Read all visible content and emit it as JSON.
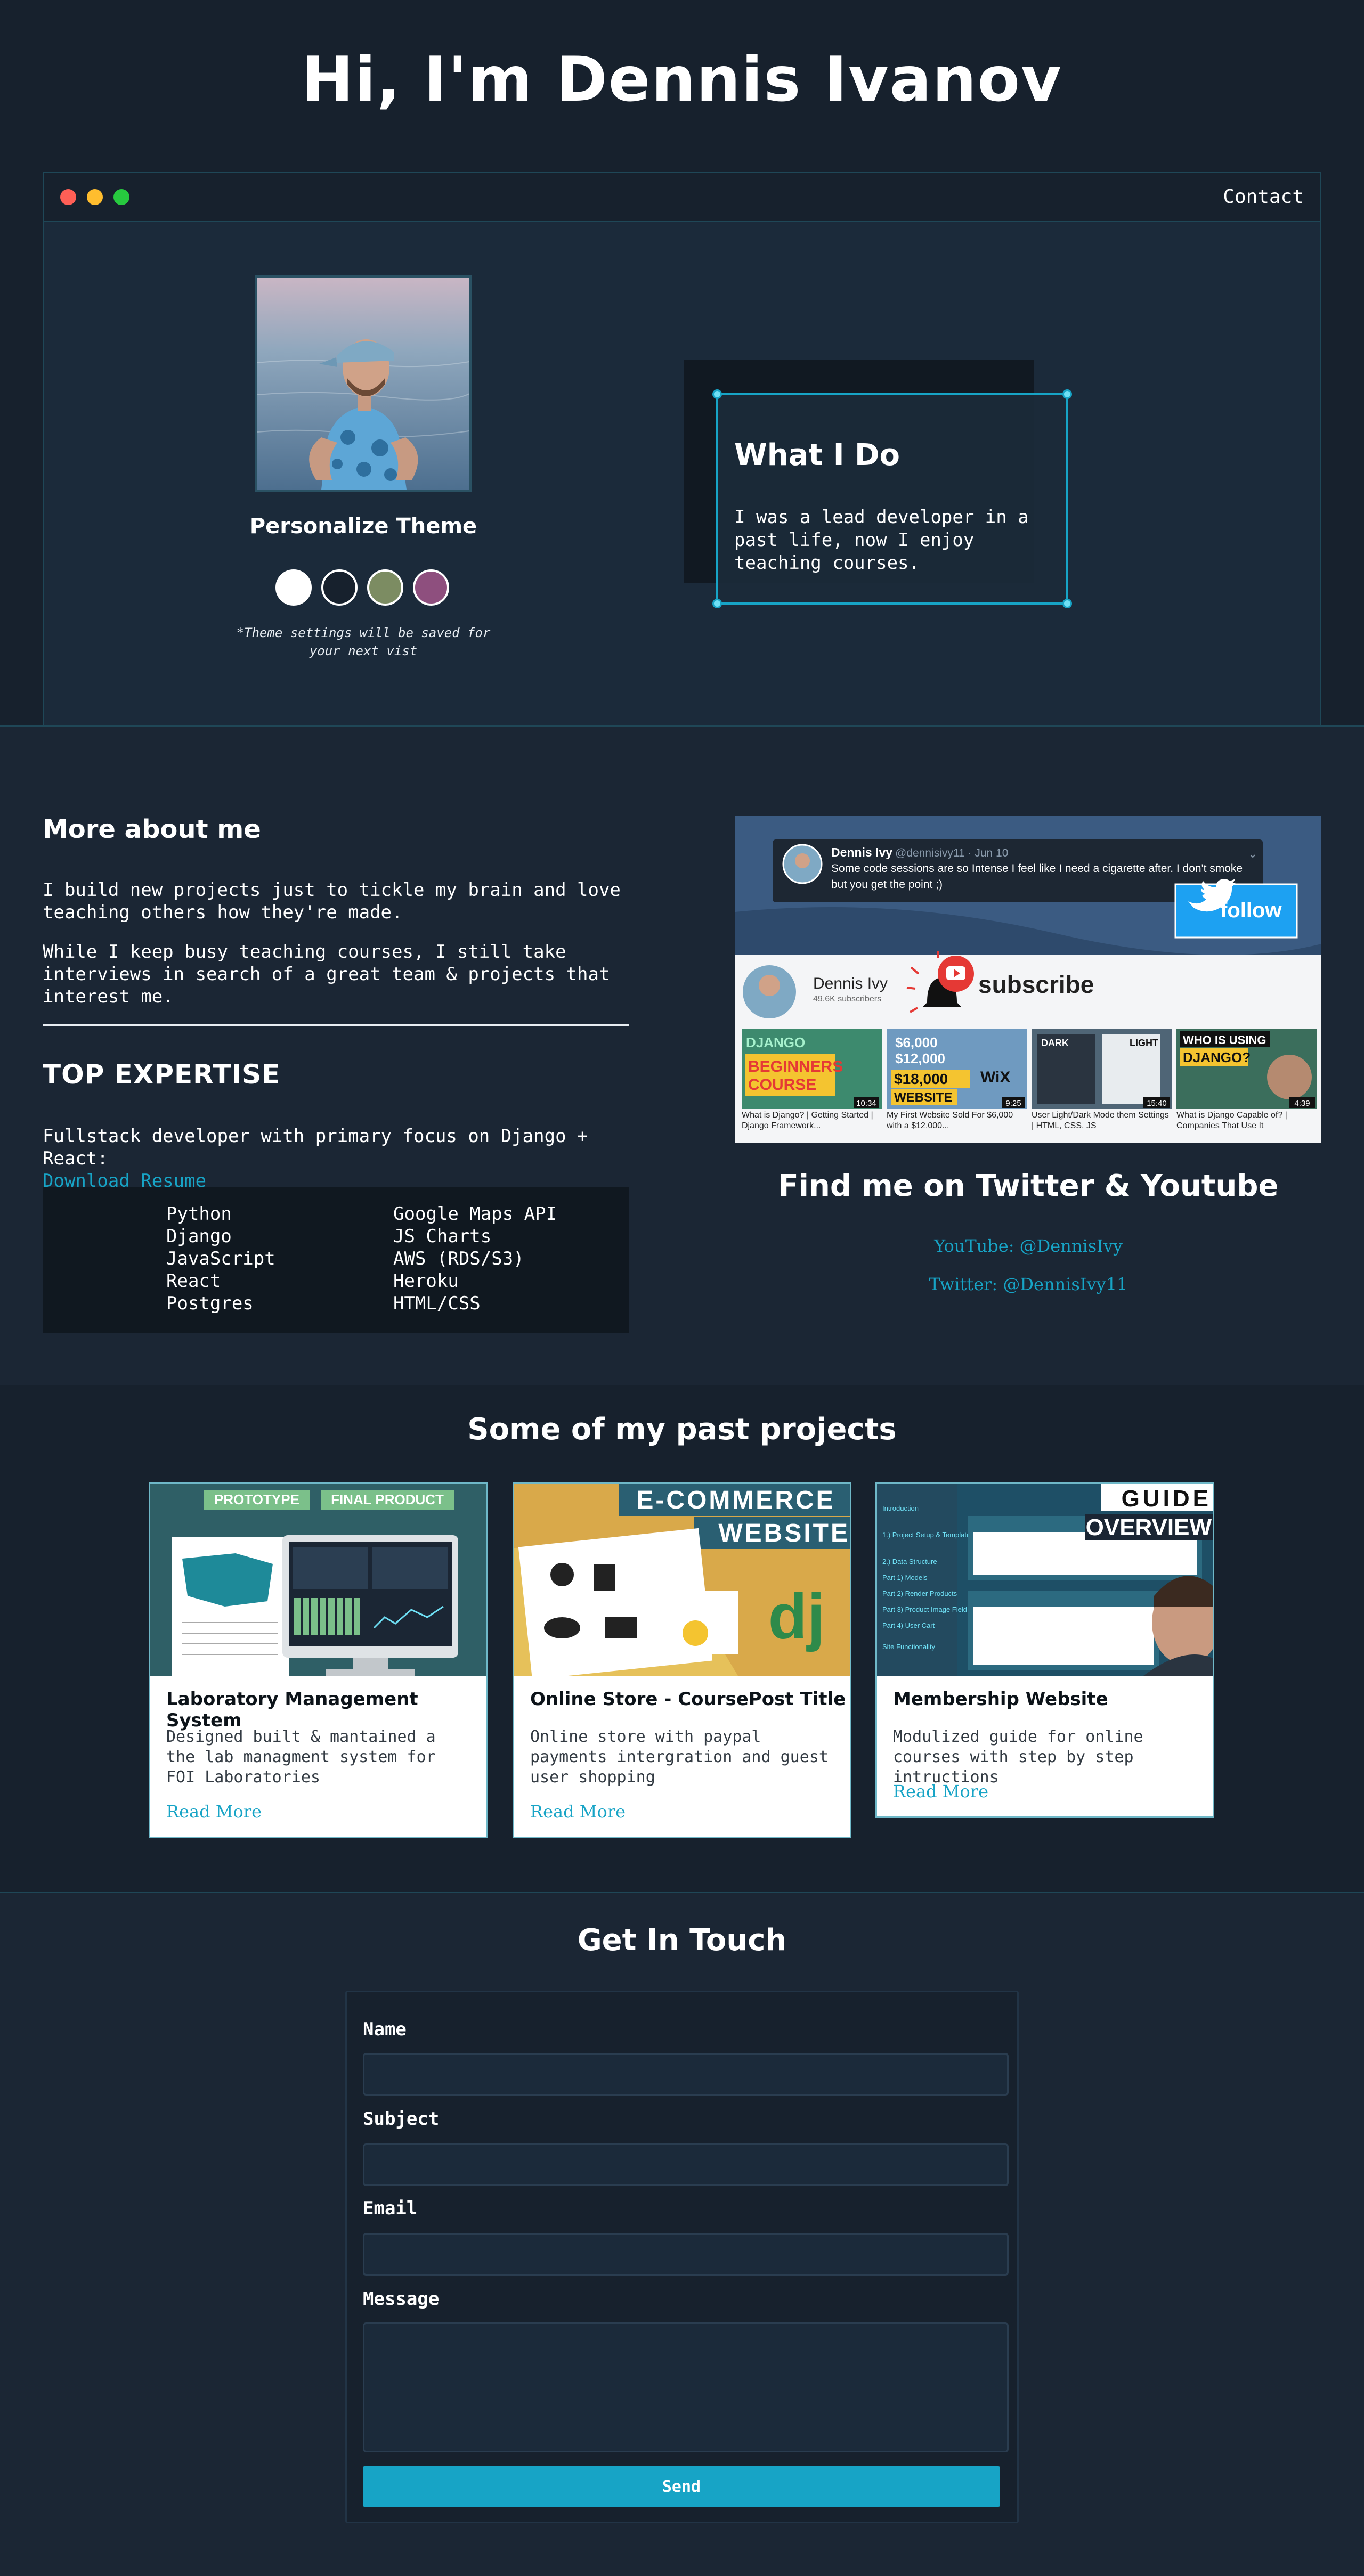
{
  "header": {
    "title": "Hi, I'm Dennis Ivanov"
  },
  "window": {
    "contact_label": "Contact"
  },
  "theme": {
    "title": "Personalize Theme",
    "note": "*Theme settings will be saved for your next vist",
    "swatches": [
      "#ffffff",
      "#17212d",
      "#7c8c62",
      "#8e4f7e"
    ]
  },
  "what_i_do": {
    "title": "What I Do",
    "text": "I was a lead developer in a past life, now I enjoy teaching courses."
  },
  "about": {
    "title": "More about me",
    "p1": "I build new projects just to tickle my brain and love teaching others how they're made.",
    "p2": "While I keep busy teaching courses, I still take interviews in search of a great team & projects that interest me."
  },
  "expertise": {
    "title": "TOP EXPERTISE",
    "text": "Fullstack developer with primary focus on Django + React:",
    "resume_label": "Download Resume",
    "skills_left": [
      "Python",
      "Django",
      "JavaScript",
      "React",
      "Postgres"
    ],
    "skills_right": [
      "Google Maps API",
      "JS Charts",
      "AWS (RDS/S3)",
      "Heroku",
      "HTML/CSS"
    ]
  },
  "social_banner": {
    "tweet_name": "Dennis Ivy",
    "tweet_handle": "@dennisivy11 · Jun 10",
    "tweet_text": "Some code sessions are so Intense I feel like I need a cigarette after. I don't smoke but you get the point ;)",
    "follow_label": "follow",
    "channel_name": "Dennis Ivy",
    "subscribers": "49.6K subscribers",
    "subscribe_label": "subscribe",
    "videos": [
      {
        "thumb_text": "DJANGO BEGINNERS COURSE",
        "duration": "10:34",
        "title": "What is Django? | Getting Started | Django Framework..."
      },
      {
        "thumb_text": "$6,000 $12,000 $18,000 WEBSITE",
        "duration": "9:25",
        "title": "My First Website Sold For $6,000 with a $12,000..."
      },
      {
        "thumb_text": "DARK LIGHT",
        "duration": "15:40",
        "title": "User Light/Dark Mode them Settings | HTML, CSS, JS"
      },
      {
        "thumb_text": "WHO IS USING DJANGO?",
        "duration": "4:39",
        "title": "What is Django Capable of? | Companies That Use It"
      }
    ]
  },
  "social": {
    "title": "Find me on Twitter & Youtube",
    "youtube": "YouTube: @DennisIvy",
    "twitter": "Twitter: @DennisIvy11"
  },
  "projects": {
    "title": "Some of my past projects",
    "items": [
      {
        "title": "Laboratory Management System",
        "desc": "Designed built & mantained a the lab managment system for FOI Laboratories",
        "link": "Read More",
        "tag1": "PROTOTYPE",
        "tag2": "FINAL PRODUCT"
      },
      {
        "title": "Online Store - CoursePost Title",
        "desc": "Online store with paypal payments intergration and guest user shopping",
        "link": "Read More",
        "tag1": "E-COMMERCE",
        "tag2": "WEBSITE"
      },
      {
        "title": "Membership Website",
        "desc": "Modulized guide for online courses with step by step intructions",
        "link": "Read More",
        "tag1": "GUIDE",
        "tag2": "OVERVIEW"
      }
    ]
  },
  "contact": {
    "title": "Get In Touch",
    "name_label": "Name",
    "subject_label": "Subject",
    "email_label": "Email",
    "message_label": "Message",
    "send_label": "Send"
  }
}
